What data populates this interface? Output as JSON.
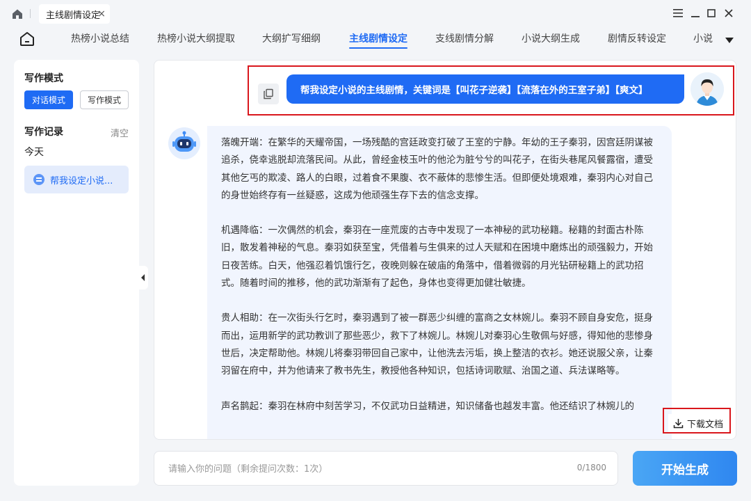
{
  "window": {
    "tab_title": "主线剧情设定",
    "tab_close": "×"
  },
  "nav": {
    "tabs": [
      "热榜小说总结",
      "热榜小说大纲提取",
      "大纲扩写细纲",
      "主线剧情设定",
      "支线剧情分解",
      "小说大纲生成",
      "剧情反转设定",
      "小说"
    ],
    "active_tab": "主线剧情设定"
  },
  "sidebar": {
    "mode_title": "写作模式",
    "mode_chat": "对话模式",
    "mode_write": "写作模式",
    "history_title": "写作记录",
    "clear": "清空",
    "today": "今天",
    "history_item": "帮我设定小说..."
  },
  "chat": {
    "user_message": "帮我设定小说的主线剧情，关键词是【叫花子逆袭】【流落在外的王室子弟】【爽文】",
    "answer_paragraphs": [
      "落魄开端：在繁华的天耀帝国，一场残酷的宫廷政变打破了王室的宁静。年幼的王子秦羽，因宫廷阴谋被追杀，侥幸逃脱却流落民间。从此，曾经金枝玉叶的他沦为脏兮兮的叫花子，在街头巷尾风餐露宿，遭受其他乞丐的欺凌、路人的白眼，过着食不果腹、衣不蔽体的悲惨生活。但即便处境艰难，秦羽内心对自己的身世始终存有一丝疑惑，这成为他顽强生存下去的信念支撑。",
      "机遇降临：一次偶然的机会，秦羽在一座荒废的古寺中发现了一本神秘的武功秘籍。秘籍的封面古朴陈旧，散发着神秘的气息。秦羽如获至宝，凭借着与生俱来的过人天赋和在困境中磨炼出的顽强毅力，开始日夜苦练。白天，他强忍着饥饿行乞，夜晚则躲在破庙的角落中，借着微弱的月光钻研秘籍上的武功招式。随着时间的推移，他的武功渐渐有了起色，身体也变得更加健壮敏捷。",
      "贵人相助：在一次街头行乞时，秦羽遇到了被一群恶少纠缠的富商之女林婉儿。秦羽不顾自身安危，挺身而出，运用新学的武功教训了那些恶少，救下了林婉儿。林婉儿对秦羽心生敬佩与好感，得知他的悲惨身世后，决定帮助他。林婉儿将秦羽带回自己家中，让他洗去污垢，换上整洁的衣衫。她还说服父亲，让秦羽留在府中，并为他请来了教书先生，教授他各种知识，包括诗词歌赋、治国之道、兵法谋略等。",
      "声名鹊起：秦羽在林府中刻苦学习，不仅武功日益精进，知识储备也越发丰富。他还结识了林婉儿的"
    ],
    "download": "下载文档"
  },
  "composer": {
    "placeholder": "请输入你的问题（剩余提问次数：1次）",
    "counter": "0/1800",
    "generate": "开始生成"
  },
  "colors": {
    "accent": "#1f6bf4",
    "highlight_box": "#d9161c"
  }
}
